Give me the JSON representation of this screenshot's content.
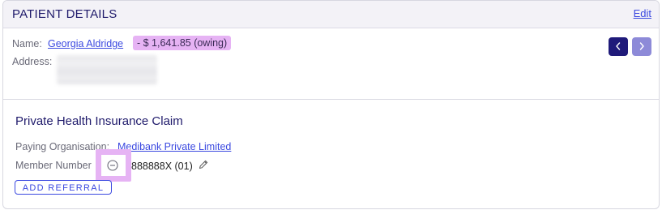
{
  "header": {
    "title": "PATIENT DETAILS",
    "edit_label": "Edit"
  },
  "patient": {
    "name_label": "Name:",
    "name": "Georgia Aldridge",
    "balance": "- $ 1,641.85 (owing)",
    "address_label": "Address:",
    "prev_icon": "chevron-left-icon",
    "next_icon": "chevron-right-icon"
  },
  "claim": {
    "title": "Private Health Insurance Claim",
    "paying_label": "Paying Organisation:",
    "paying_value": "Medibank Private Limited",
    "member_label": "Member Number",
    "member_icon": "minus-circle-icon",
    "member_value": "888888X (01)",
    "edit_icon": "pencil-icon",
    "add_referral_label": "ADD REFERRAL"
  },
  "colors": {
    "accent": "#3b49e0",
    "heading": "#1f1a6b",
    "highlight": "#e6b3f4",
    "nav_active": "#1f1a7a",
    "nav_inactive": "#8d8ad8"
  }
}
